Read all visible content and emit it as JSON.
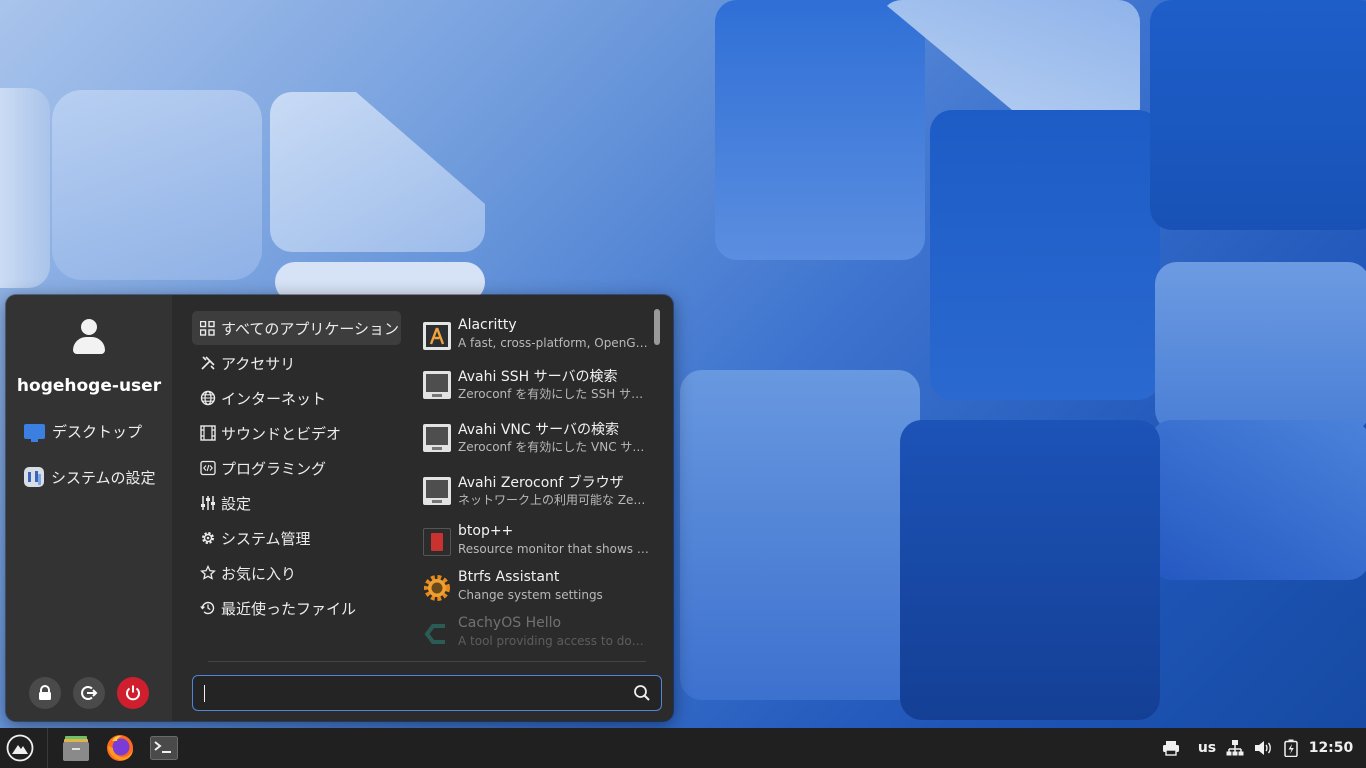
{
  "user": {
    "name": "hogehoge-user"
  },
  "left_panel": {
    "links": [
      {
        "label": "デスクトップ",
        "icon": "desktop-icon"
      },
      {
        "label": "システムの設定",
        "icon": "settings-icon"
      }
    ],
    "session_buttons": [
      "lock-icon",
      "logout-icon",
      "power-icon"
    ]
  },
  "categories": [
    {
      "label": "すべてのアプリケーション",
      "icon": "grid-icon",
      "selected": true
    },
    {
      "label": "アクセサリ",
      "icon": "tools-icon"
    },
    {
      "label": "インターネット",
      "icon": "globe-icon"
    },
    {
      "label": "サウンドとビデオ",
      "icon": "media-icon"
    },
    {
      "label": "プログラミング",
      "icon": "code-icon"
    },
    {
      "label": "設定",
      "icon": "sliders-icon"
    },
    {
      "label": "システム管理",
      "icon": "gear-icon"
    },
    {
      "label": "お気に入り",
      "icon": "star-icon"
    },
    {
      "label": "最近使ったファイル",
      "icon": "history-icon"
    }
  ],
  "apps": [
    {
      "name": "Alacritty",
      "desc": "A fast, cross-platform, OpenGL terminal emulator",
      "icon": "alacritty-icon"
    },
    {
      "name": "Avahi SSH サーバの検索",
      "desc": "Zeroconf を有効にした SSH サーバを検索します",
      "icon": "network-monitor-icon"
    },
    {
      "name": "Avahi VNC サーバの検索",
      "desc": "Zeroconf を有効にした VNC サーバを検索します",
      "icon": "network-monitor-icon"
    },
    {
      "name": "Avahi Zeroconf ブラウザ",
      "desc": "ネットワーク上の利用可能な Zeroconf サービスを閲覧します",
      "icon": "network-monitor-icon"
    },
    {
      "name": "btop++",
      "desc": "Resource monitor that shows usage and stats",
      "icon": "btop-icon"
    },
    {
      "name": "Btrfs Assistant",
      "desc": "Change system settings",
      "icon": "btrfs-assistant-icon"
    },
    {
      "name": "CachyOS Hello",
      "desc": "A tool providing access to documentation",
      "icon": "cachyos-hello-icon"
    }
  ],
  "search": {
    "value": "",
    "placeholder": ""
  },
  "taskbar": {
    "launchers": [
      "cachyos-menu-icon",
      "file-manager-icon",
      "firefox-icon",
      "terminal-icon"
    ],
    "tray": {
      "keyboard_layout": "us",
      "clock": "12:50"
    }
  },
  "colors": {
    "accent": "#3b7fe0",
    "power": "#cf1f2e",
    "menu_bg": "#2b2b2b",
    "taskbar_bg": "#202020"
  }
}
